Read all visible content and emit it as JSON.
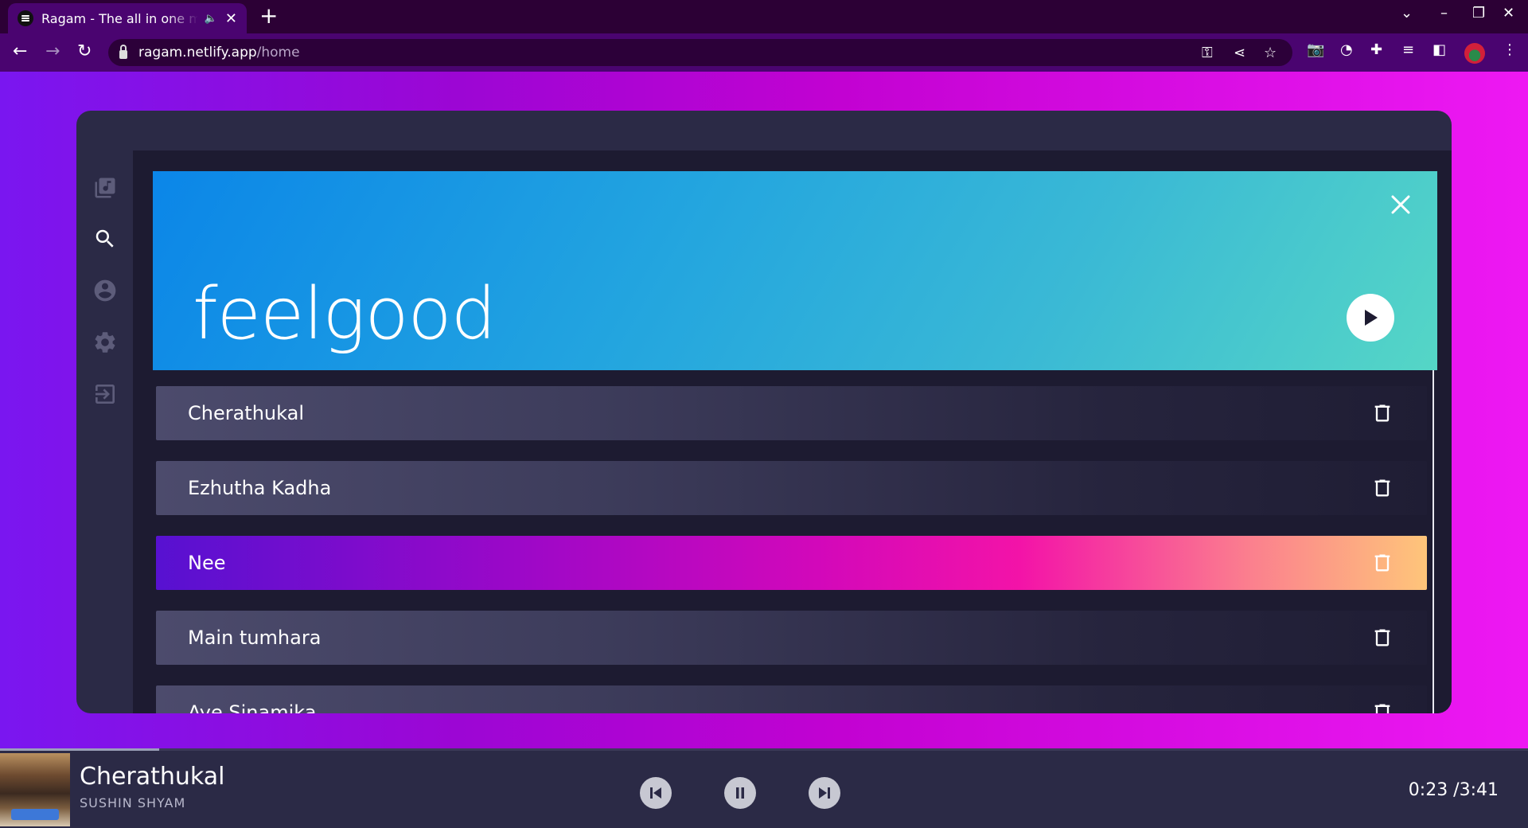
{
  "browser": {
    "tab_title": "Ragam - The all in one music",
    "audio_icon": "🔈",
    "url_host": "ragam.netlify.app",
    "url_path": "/home"
  },
  "sidebar": {
    "items": [
      {
        "name": "library-icon"
      },
      {
        "name": "search-icon"
      },
      {
        "name": "account-icon"
      },
      {
        "name": "settings-icon"
      },
      {
        "name": "logout-icon"
      }
    ]
  },
  "playlist": {
    "title": "feelgood",
    "songs": [
      {
        "name": "Cherathukal",
        "active": false
      },
      {
        "name": "Ezhutha Kadha",
        "active": false
      },
      {
        "name": "Nee",
        "active": true
      },
      {
        "name": "Main tumhara",
        "active": false
      },
      {
        "name": "Aye Sinamika",
        "active": false
      }
    ]
  },
  "player": {
    "title": "Cherathukal",
    "artist": "SUSHIN SHYAM",
    "elapsed": "0:23",
    "duration": "3:41",
    "time_display": "0:23 /3:41",
    "progress": 0.104
  },
  "colors": {
    "page_gradient_start": "#7a16f0",
    "page_gradient_end": "#ee18f3",
    "card_bg": "#2b2a46",
    "banner_start": "#0b86e8",
    "banner_end": "#55d6c6",
    "active_row_start": "#5711d1",
    "active_row_end": "#fec57a"
  }
}
